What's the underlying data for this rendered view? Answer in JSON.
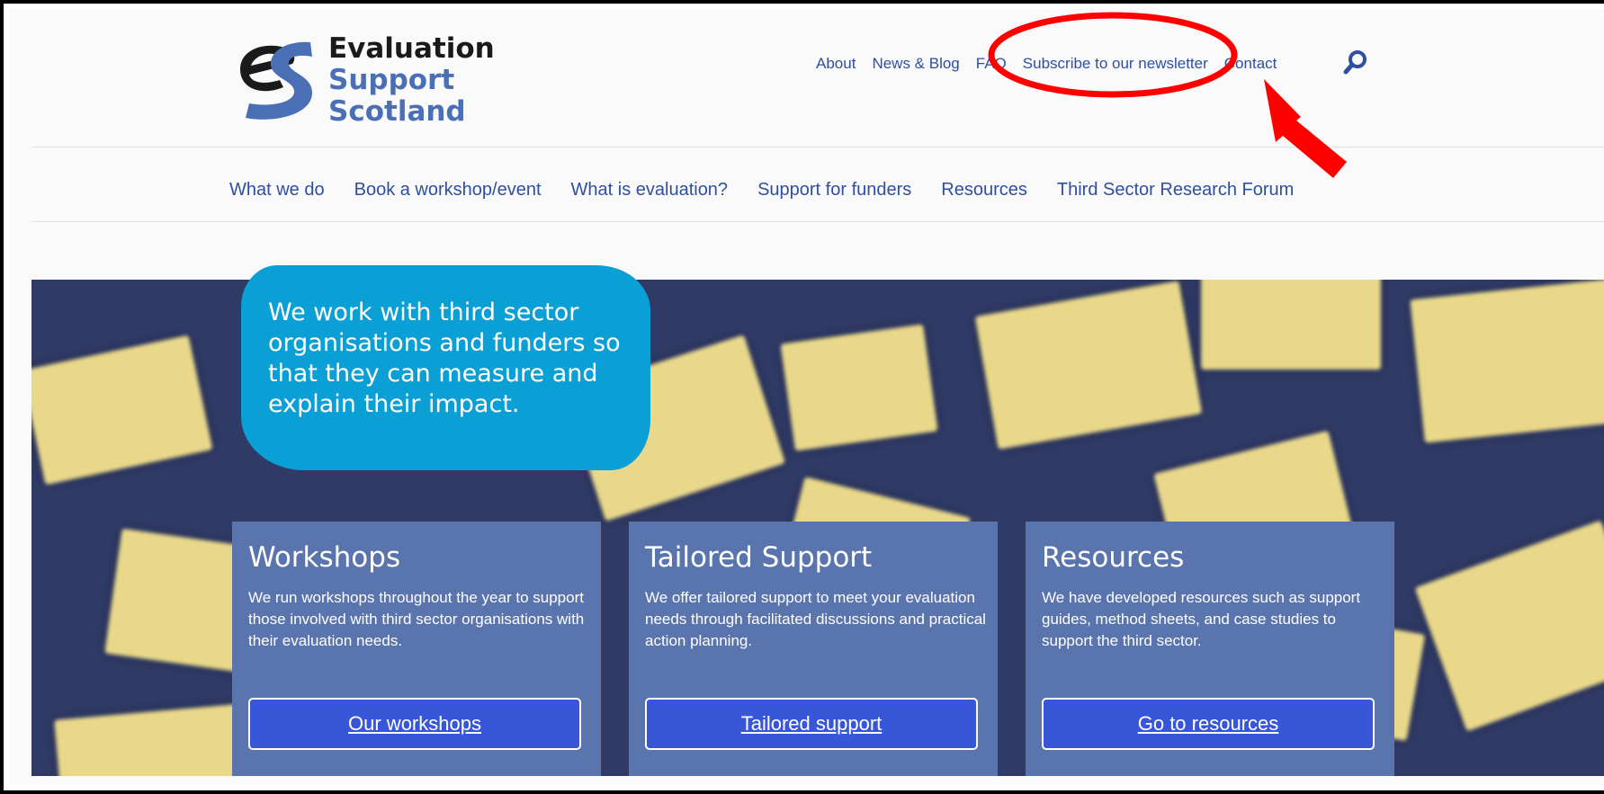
{
  "logo": {
    "line1": "Evaluation",
    "line2": "Support",
    "line3": "Scotland",
    "icon": "es-logo-icon"
  },
  "top_nav": [
    "About",
    "News & Blog",
    "FAQ",
    "Subscribe to our newsletter",
    "Contact"
  ],
  "search_icon": "search-icon",
  "main_nav": [
    "What we do",
    "Book a workshop/event",
    "What is evaluation?",
    "Support for funders",
    "Resources",
    "Third Sector Research Forum"
  ],
  "hero": {
    "bubble_text": "We work with third sector organisations and funders so that they can measure and explain their impact."
  },
  "cards": [
    {
      "title": "Workshops",
      "description": "We run workshops throughout the year to support those involved with third sector organisations with their evaluation needs.",
      "button": "Our workshops"
    },
    {
      "title": "Tailored Support",
      "description": "We offer tailored support to meet your evaluation needs through facilitated discussions and practical action planning.",
      "button": "Tailored support"
    },
    {
      "title": "Resources",
      "description": "We have developed resources such as support guides, method sheets, and case studies to support the third sector.",
      "button": "Go to resources"
    }
  ],
  "annotation": {
    "color": "#ff0000",
    "highlight_target": "Subscribe to our newsletter"
  },
  "colors": {
    "link": "#2e4fa0",
    "brand_blue": "#4b6fb5",
    "bubble": "#0aa0d6",
    "card": "#5a74ad",
    "button": "#3856d8"
  }
}
